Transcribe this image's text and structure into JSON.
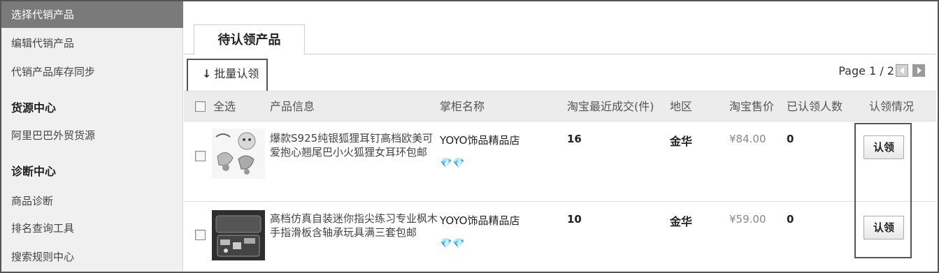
{
  "sidebar": {
    "items": [
      {
        "label": "选择代销产品",
        "active": true
      },
      {
        "label": "编辑代销产品"
      },
      {
        "label": "代销产品库存同步"
      }
    ],
    "sections": [
      {
        "heading": "货源中心",
        "items": [
          "阿里巴巴外贸货源"
        ]
      },
      {
        "heading": "诊断中心",
        "items": [
          "商品诊断",
          "排名查询工具",
          "搜索规则中心"
        ]
      }
    ]
  },
  "tabs": [
    {
      "label": "待认领产品"
    }
  ],
  "toolbar": {
    "batch_label": "批量认领",
    "page_text": "Page 1 / 2"
  },
  "table": {
    "headers": {
      "select_all": "全选",
      "product": "产品信息",
      "shop": "掌柜名称",
      "sales": "淘宝最近成交(件)",
      "region": "地区",
      "price": "淘宝售价",
      "claimed": "已认领人数",
      "status": "认领情况"
    },
    "rows": [
      {
        "title": "爆款S925纯银狐狸耳钉高档欧美可爱抱心翘尾巴小火狐狸女耳环包邮",
        "shop": "YOYO饰品精品店",
        "gems": "💎💎",
        "sales": "16",
        "region": "金华",
        "price": "¥84.00",
        "claimed": "0",
        "action": "认领"
      },
      {
        "title": "高档仿真自装迷你指尖练习专业枫木手指滑板含轴承玩具满三套包邮",
        "shop": "YOYO饰品精品店",
        "gems": "💎💎",
        "sales": "10",
        "region": "金华",
        "price": "¥59.00",
        "claimed": "0",
        "action": "认领"
      }
    ]
  }
}
